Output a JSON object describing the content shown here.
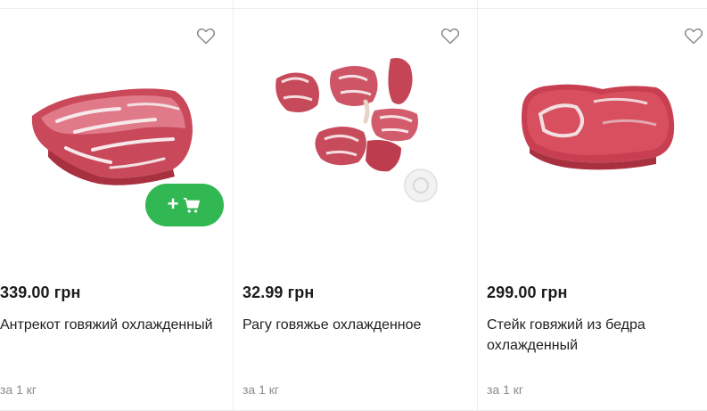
{
  "products": [
    {
      "price": "339.00 грн",
      "title": "Антрекот говяжий охлажденный",
      "unit": "за 1 кг",
      "image_icon": "beef-entrecote-image",
      "favorite_icon": "heart-outline-icon",
      "add_to_cart_label": "+"
    },
    {
      "price": "32.99 грн",
      "title": "Рагу говяжье охлажденное",
      "unit": "за 1 кг",
      "image_icon": "beef-ragout-image",
      "favorite_icon": "heart-outline-icon"
    },
    {
      "price": "299.00 грн",
      "title": "Стейк говяжий из бедра охлажденный",
      "unit": "за 1 кг",
      "image_icon": "beef-thigh-steak-image",
      "favorite_icon": "heart-outline-icon"
    }
  ],
  "colors": {
    "add_to_cart_bg": "#32b852",
    "price_text": "#1c1c1c",
    "unit_text": "#8b8b8b",
    "border": "#ececec"
  }
}
